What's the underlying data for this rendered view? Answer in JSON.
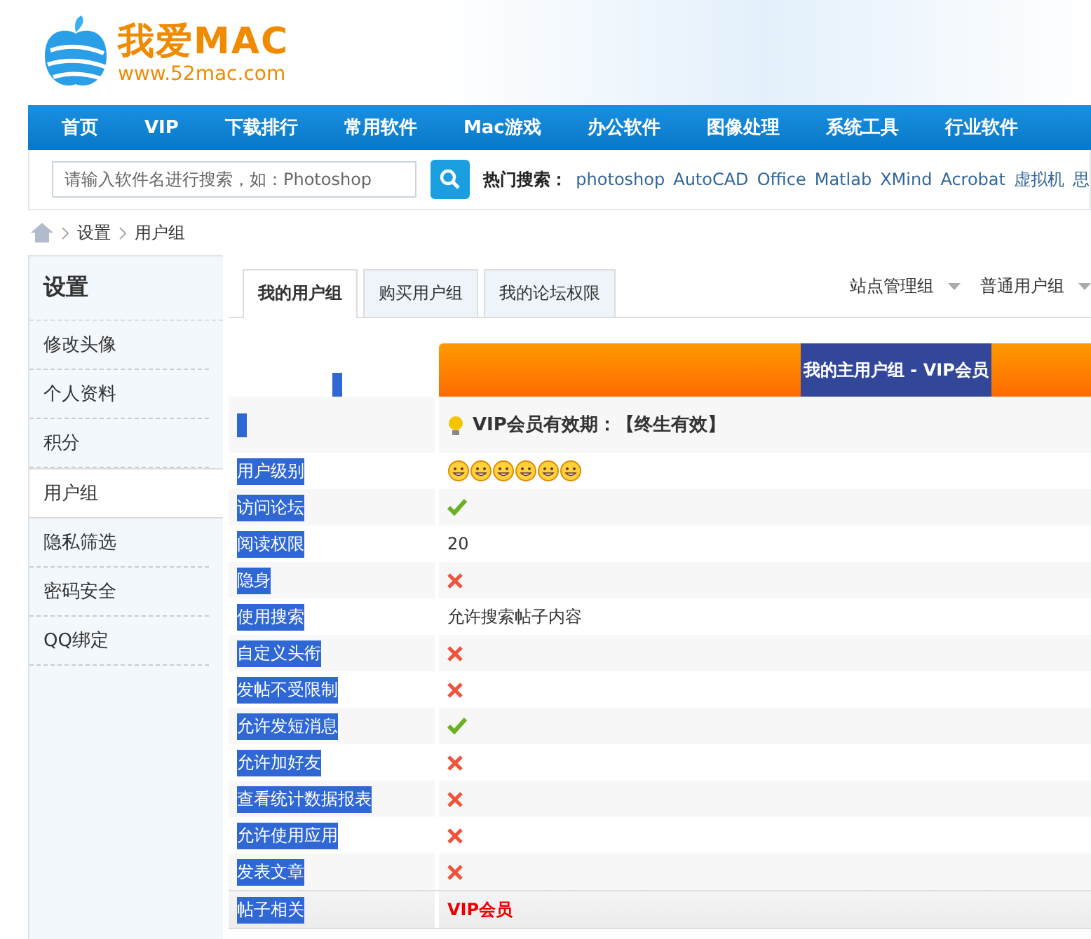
{
  "logo": {
    "name": "我爱MAC",
    "url": "www.52mac.com"
  },
  "nav": [
    "首页",
    "VIP",
    "下载排行",
    "常用软件",
    "Mac游戏",
    "办公软件",
    "图像处理",
    "系统工具",
    "行业软件"
  ],
  "search": {
    "placeholder": "请输入软件名进行搜索，如：Photoshop",
    "hot_label": "热门搜索：",
    "hot": [
      "photoshop",
      "AutoCAD",
      "Office",
      "Matlab",
      "XMind",
      "Acrobat",
      "虚拟机",
      "思"
    ]
  },
  "breadcrumb": [
    "设置",
    "用户组"
  ],
  "sidebar": {
    "title": "设置",
    "items": [
      {
        "label": "修改头像",
        "selected": false
      },
      {
        "label": "个人资料",
        "selected": false
      },
      {
        "label": "积分",
        "selected": false
      },
      {
        "label": "用户组",
        "selected": true
      },
      {
        "label": "隐私筛选",
        "selected": false
      },
      {
        "label": "密码安全",
        "selected": false
      },
      {
        "label": "QQ绑定",
        "selected": false
      }
    ]
  },
  "tabs": [
    {
      "label": "我的用户组",
      "selected": true
    },
    {
      "label": "购买用户组",
      "selected": false
    },
    {
      "label": "我的论坛权限",
      "selected": false
    }
  ],
  "dropdowns": [
    "站点管理组",
    "普通用户组"
  ],
  "table": {
    "header": "我的主用户组 - VIP会员",
    "expiry": "VIP会员有效期：【终生有效】",
    "rows": [
      {
        "label": "用户级别",
        "kind": "stars",
        "stars": 6
      },
      {
        "label": "访问论坛",
        "kind": "check",
        "on": true
      },
      {
        "label": "阅读权限",
        "kind": "text",
        "value": "20"
      },
      {
        "label": "隐身",
        "kind": "check",
        "on": false
      },
      {
        "label": "使用搜索",
        "kind": "text",
        "value": "允许搜索帖子内容"
      },
      {
        "label": "自定义头衔",
        "kind": "check",
        "on": false
      },
      {
        "label": "发帖不受限制",
        "kind": "check",
        "on": false
      },
      {
        "label": "允许发短消息",
        "kind": "check",
        "on": true
      },
      {
        "label": "允许加好友",
        "kind": "check",
        "on": false
      },
      {
        "label": "查看统计数据报表",
        "kind": "check",
        "on": false
      },
      {
        "label": "允许使用应用",
        "kind": "check",
        "on": false
      },
      {
        "label": "发表文章",
        "kind": "check",
        "on": false
      },
      {
        "label": "帖子相关",
        "kind": "section",
        "value": "VIP会员"
      }
    ]
  }
}
